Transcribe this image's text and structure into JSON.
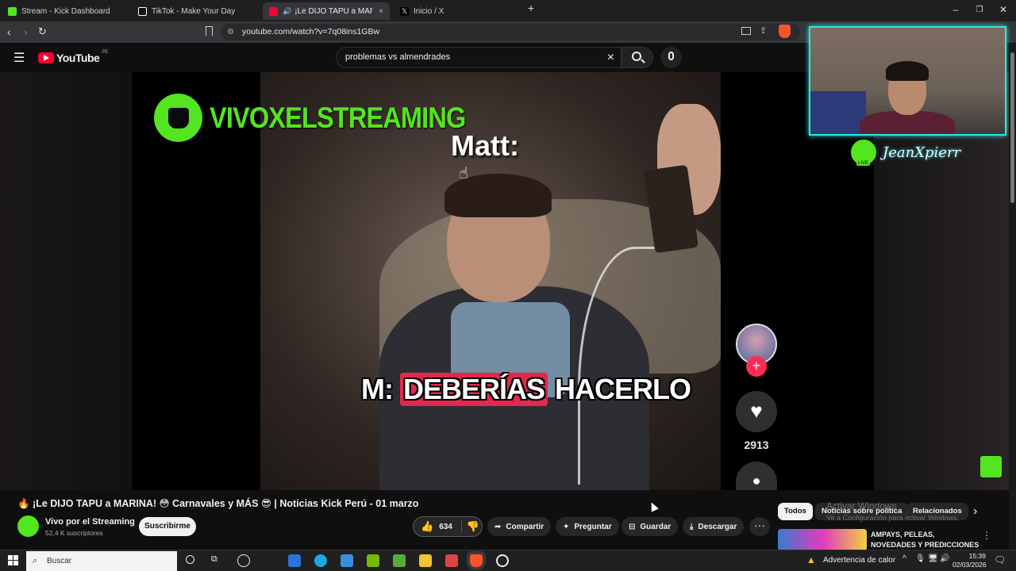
{
  "browser": {
    "tabs": [
      {
        "title": "Stream - Kick Dashboard",
        "favicon_color": "#53e51f"
      },
      {
        "title": "TikTok - Make Your Day",
        "favicon_color": "#ffffff"
      },
      {
        "title": "¡Le DIJO TAPU a MARINA!",
        "favicon_color": "#ff0033",
        "active": true
      },
      {
        "title": "Inicio / X",
        "favicon_color": "#ffffff"
      }
    ],
    "url": "youtube.com/watch?v=7q08ins1GBw",
    "new_tab": "+",
    "close": "×"
  },
  "youtube": {
    "logo_text": "YouTube",
    "country": "PE",
    "search_value": "problemas vs almendrades",
    "clear": "×"
  },
  "video": {
    "brand_text": "VIVOXELSTREAMING",
    "overlay_top": "Matt:",
    "caption_prefix": "M:",
    "caption_highlight": "DEBERÍAS",
    "caption_suffix": "HACERLO",
    "like_count": "2913",
    "plus": "+"
  },
  "webcam": {
    "streamer_name": "JeanXpierr",
    "live_badge": "LIVE"
  },
  "watch": {
    "title": "🔥 ¡Le DIJO TAPU a MARINA! 😳 Carnavales y MÁS 😎 | Noticias Kick Perú - 01 marzo",
    "channel_name": "Vivo por el Streaming",
    "subscribers": "52,4 K suscriptores",
    "subscribe_label": "Suscribirme",
    "likes": "634",
    "share_label": "Compartir",
    "ask_label": "Preguntar",
    "save_label": "Guardar",
    "download_label": "Descargar",
    "more": "···"
  },
  "sidebar": {
    "chips": [
      "Todos",
      "Noticias sobre política",
      "Relacionados"
    ],
    "next_chip": "›",
    "activate_title": "Activar Windows",
    "activate_sub": "Ve a Configuración para activar Windows.",
    "rec_title": "AMPAYS, PELEAS, NOVEDADES Y PREDICCIONES DEL FUTUR...",
    "rec_menu": "⋮"
  },
  "taskbar": {
    "search_placeholder": "Buscar",
    "weather": "Advertencia de calor",
    "time": "15:39",
    "date": "02/03/2026"
  }
}
